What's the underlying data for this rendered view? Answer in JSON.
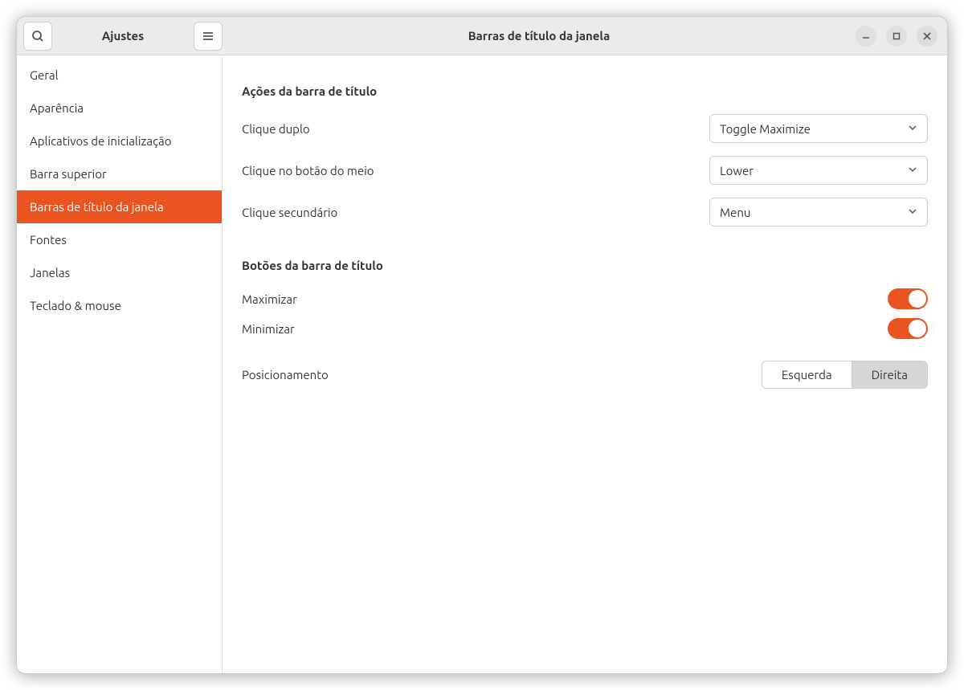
{
  "header": {
    "sidebar_title": "Ajustes",
    "page_title": "Barras de título da janela"
  },
  "sidebar": {
    "items": [
      {
        "label": "Geral",
        "active": false
      },
      {
        "label": "Aparência",
        "active": false
      },
      {
        "label": "Aplicativos de inicialização",
        "active": false
      },
      {
        "label": "Barra superior",
        "active": false
      },
      {
        "label": "Barras de título da janela",
        "active": true
      },
      {
        "label": "Fontes",
        "active": false
      },
      {
        "label": "Janelas",
        "active": false
      },
      {
        "label": "Teclado & mouse",
        "active": false
      }
    ]
  },
  "content": {
    "section1": {
      "title": "Ações da barra de título",
      "double_click_label": "Clique duplo",
      "double_click_value": "Toggle Maximize",
      "middle_click_label": "Clique no botão do meio",
      "middle_click_value": "Lower",
      "secondary_click_label": "Clique secundário",
      "secondary_click_value": "Menu"
    },
    "section2": {
      "title": "Botões da barra de título",
      "maximize_label": "Maximizar",
      "maximize_value": true,
      "minimize_label": "Minimizar",
      "minimize_value": true,
      "placement_label": "Posicionamento",
      "placement_left": "Esquerda",
      "placement_right": "Direita",
      "placement_selected": "Direita"
    }
  },
  "colors": {
    "accent": "#e95420"
  }
}
